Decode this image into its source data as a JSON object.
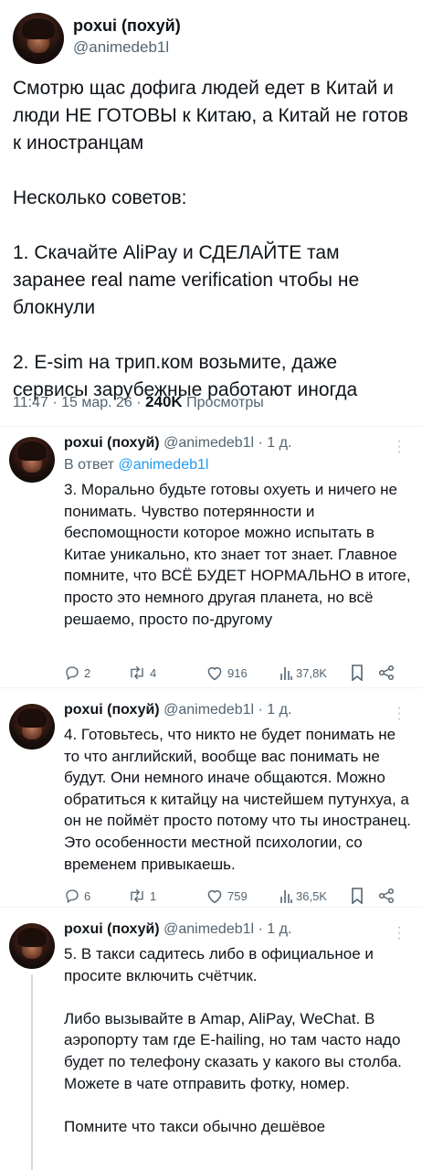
{
  "main_tweet": {
    "author_name": "роxui (похуй)",
    "author_handle": "@animedeb1l",
    "text": "Смотрю щас дофига людей едет в Китай и люди НЕ ГОТОВЫ к Китаю, а Китай не готов к иностранцам\n\nНесколько советов:\n\n1. Скачайте AliPay и СДЕЛАЙТЕ там заранее real name verification чтобы не блокнули\n\n2. E-sim на трип.ком возьмите, даже сервисы зарубежные работают иногда",
    "time": "11:47",
    "sep1": "·",
    "date": "15 мар. 26",
    "sep2": "·",
    "views_count": "240K",
    "views_label": "Просмотры"
  },
  "replies": [
    {
      "author_name": "роxui (похуй)",
      "author_handle": "@animedeb1l",
      "sep": "·",
      "age": "1 д.",
      "reply_to_prefix": "В ответ",
      "reply_to_handle": "@animedeb1l",
      "text": "3. Морально будьте готовы охуеть и ничего не понимать. Чувство потерянности и беспомощности которое можно испытать в Китае уникально, кто знает тот знает. Главное помните, что ВСЁ БУДЕТ НОРМАЛЬНО в итоге, просто это немного другая планета, но всё решаемо, просто по-другому",
      "replies_count": "2",
      "retweets_count": "4",
      "likes_count": "916",
      "views_count": "37,8K"
    },
    {
      "author_name": "роxui (похуй)",
      "author_handle": "@animedeb1l",
      "sep": "·",
      "age": "1 д.",
      "text": "4. Готовьтесь, что никто не будет понимать не то что английский, вообще вас понимать не будут. Они немного иначе общаются. Можно обратиться к китайцу на чистейшем путунхуа, а он не поймёт просто потому что ты иностранец. Это особенности местной психологии, со временем привыкаешь.",
      "replies_count": "6",
      "retweets_count": "1",
      "likes_count": "759",
      "views_count": "36,5K"
    },
    {
      "author_name": "роxui (похуй)",
      "author_handle": "@animedeb1l",
      "sep": "·",
      "age": "1 д.",
      "text": "5. В такси садитесь либо в официальное и просите включить счётчик.\n\nЛибо вызывайте в Amap, AliPay, WeChat. В аэропорту там где E-hailing, но там часто надо будет по телефону сказать у какого вы столба. Можете в чате отправить фотку, номер.\n\nПомните что такси обычно дешёвое"
    }
  ],
  "colors": {
    "text": "#0f1419",
    "secondary": "#536471",
    "link": "#1d9bf0",
    "divider": "#eff3f4",
    "thread_line": "#cfd9de"
  }
}
